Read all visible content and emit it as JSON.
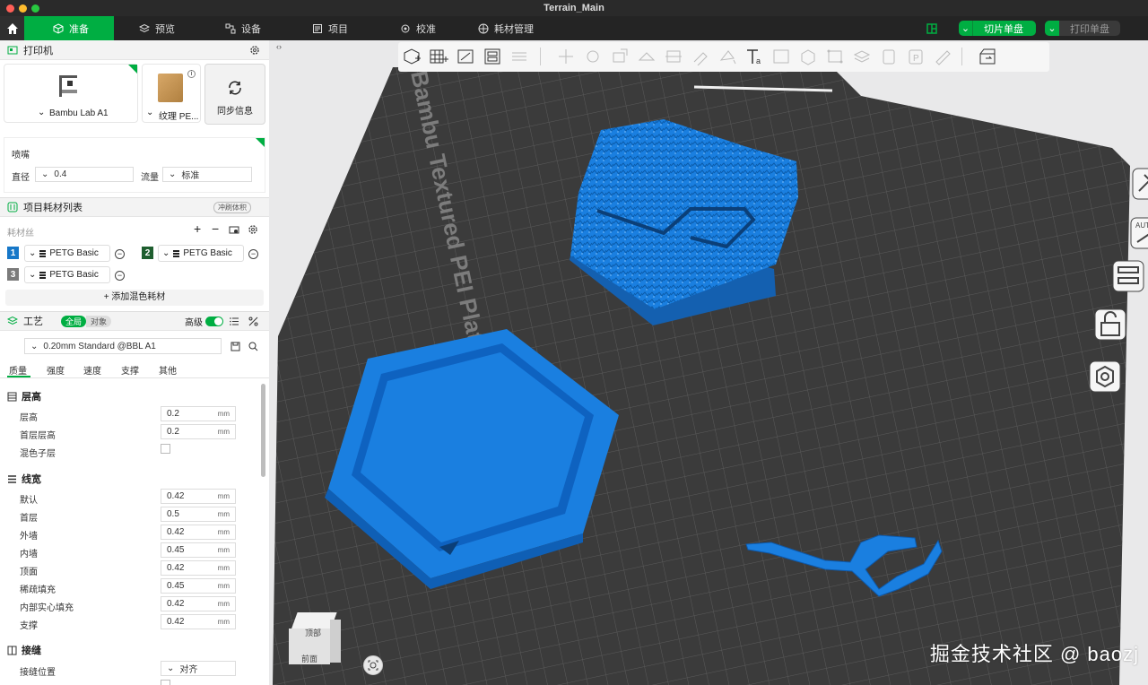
{
  "window": {
    "title": "Terrain_Main"
  },
  "nav": {
    "tabs": [
      {
        "label": "准备",
        "icon": "cube-icon",
        "active": true
      },
      {
        "label": "预览",
        "icon": "layers-icon"
      },
      {
        "label": "设备",
        "icon": "device-icon"
      },
      {
        "label": "项目",
        "icon": "document-icon"
      },
      {
        "label": "校准",
        "icon": "calibrate-icon"
      },
      {
        "label": "耗材管理",
        "icon": "spool-icon"
      }
    ],
    "slice_button": "切片单盘",
    "print_button": "打印单盘"
  },
  "printer": {
    "section_title": "打印机",
    "printer_name": "Bambu Lab A1",
    "plate_name": "纹理 PE...",
    "sync_label": "同步信息",
    "nozzle_label": "喷嘴",
    "diameter_label": "直径",
    "diameter_value": "0.4",
    "flow_label": "流量",
    "flow_value": "标准"
  },
  "filaments": {
    "section_title": "项目耗材列表",
    "flush_badge": "冲刷体积",
    "list_label": "耗材丝",
    "items": [
      {
        "index": "1",
        "name": "PETG Basic",
        "color": "#1677c8"
      },
      {
        "index": "2",
        "name": "PETG Basic",
        "color": "#1e5e2f"
      },
      {
        "index": "3",
        "name": "PETG Basic",
        "color": "#7b7b7b"
      }
    ],
    "add_mix_label": "+ 添加混色耗材"
  },
  "process": {
    "section_title": "工艺",
    "scope_global": "全局",
    "scope_object": "对象",
    "advanced_label": "高级",
    "preset": "0.20mm Standard @BBL A1",
    "tabs": [
      "质量",
      "强度",
      "速度",
      "支撑",
      "其他"
    ],
    "groups": {
      "layer_height": {
        "title": "层高",
        "rows": [
          {
            "label": "层高",
            "value": "0.2",
            "unit": "mm"
          },
          {
            "label": "首层层高",
            "value": "0.2",
            "unit": "mm"
          }
        ],
        "mix_label": "混色子层"
      },
      "line_width": {
        "title": "线宽",
        "rows": [
          {
            "label": "默认",
            "value": "0.42",
            "unit": "mm"
          },
          {
            "label": "首层",
            "value": "0.5",
            "unit": "mm"
          },
          {
            "label": "外墙",
            "value": "0.42",
            "unit": "mm"
          },
          {
            "label": "内墙",
            "value": "0.45",
            "unit": "mm"
          },
          {
            "label": "顶面",
            "value": "0.42",
            "unit": "mm"
          },
          {
            "label": "稀疏填充",
            "value": "0.45",
            "unit": "mm"
          },
          {
            "label": "内部实心填充",
            "value": "0.42",
            "unit": "mm"
          },
          {
            "label": "支撑",
            "value": "0.42",
            "unit": "mm"
          }
        ]
      },
      "seam": {
        "title": "接缝",
        "position_label": "接缝位置",
        "position_value": "对齐"
      }
    }
  },
  "viewport": {
    "plate_label": "Bambu Textured PEI Plate",
    "cube_top": "顶部",
    "cube_front": "前面",
    "watermark": "掘金技术社区 @ baozj",
    "model_color": "#1a7fe0"
  }
}
